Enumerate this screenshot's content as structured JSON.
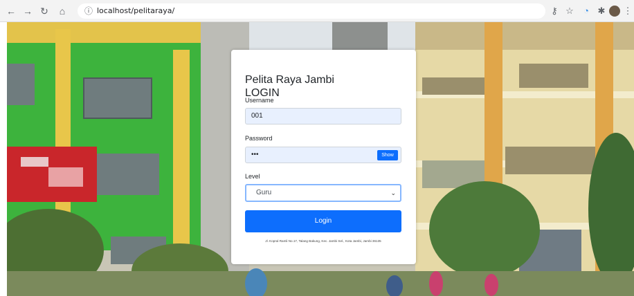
{
  "browser": {
    "url": "localhost/pelitaraya/",
    "icons": [
      "back-arrow-icon",
      "forward-arrow-icon",
      "reload-icon",
      "home-icon",
      "info-icon",
      "key-icon",
      "star-icon",
      "extension-icon",
      "puzzle-icon",
      "avatar",
      "menu-icon"
    ]
  },
  "login": {
    "school_name": "Pelita Raya Jambi",
    "heading": "LOGIN",
    "username_label": "Username",
    "username_value": "001",
    "password_label": "Password",
    "password_value": "•••",
    "show_label": "Show",
    "level_label": "Level",
    "level_selected": "Guru",
    "submit_label": "Login",
    "address": "Jl. Kopral Ramli No.17, Talang Bakung, Kec. Jambi Sel., Kota Jambi, Jambi 36135"
  },
  "colors": {
    "primary": "#0d6efd",
    "autofill": "#e8f0fe",
    "building_green": "#3db33d",
    "building_yellow": "#e8c64a"
  }
}
